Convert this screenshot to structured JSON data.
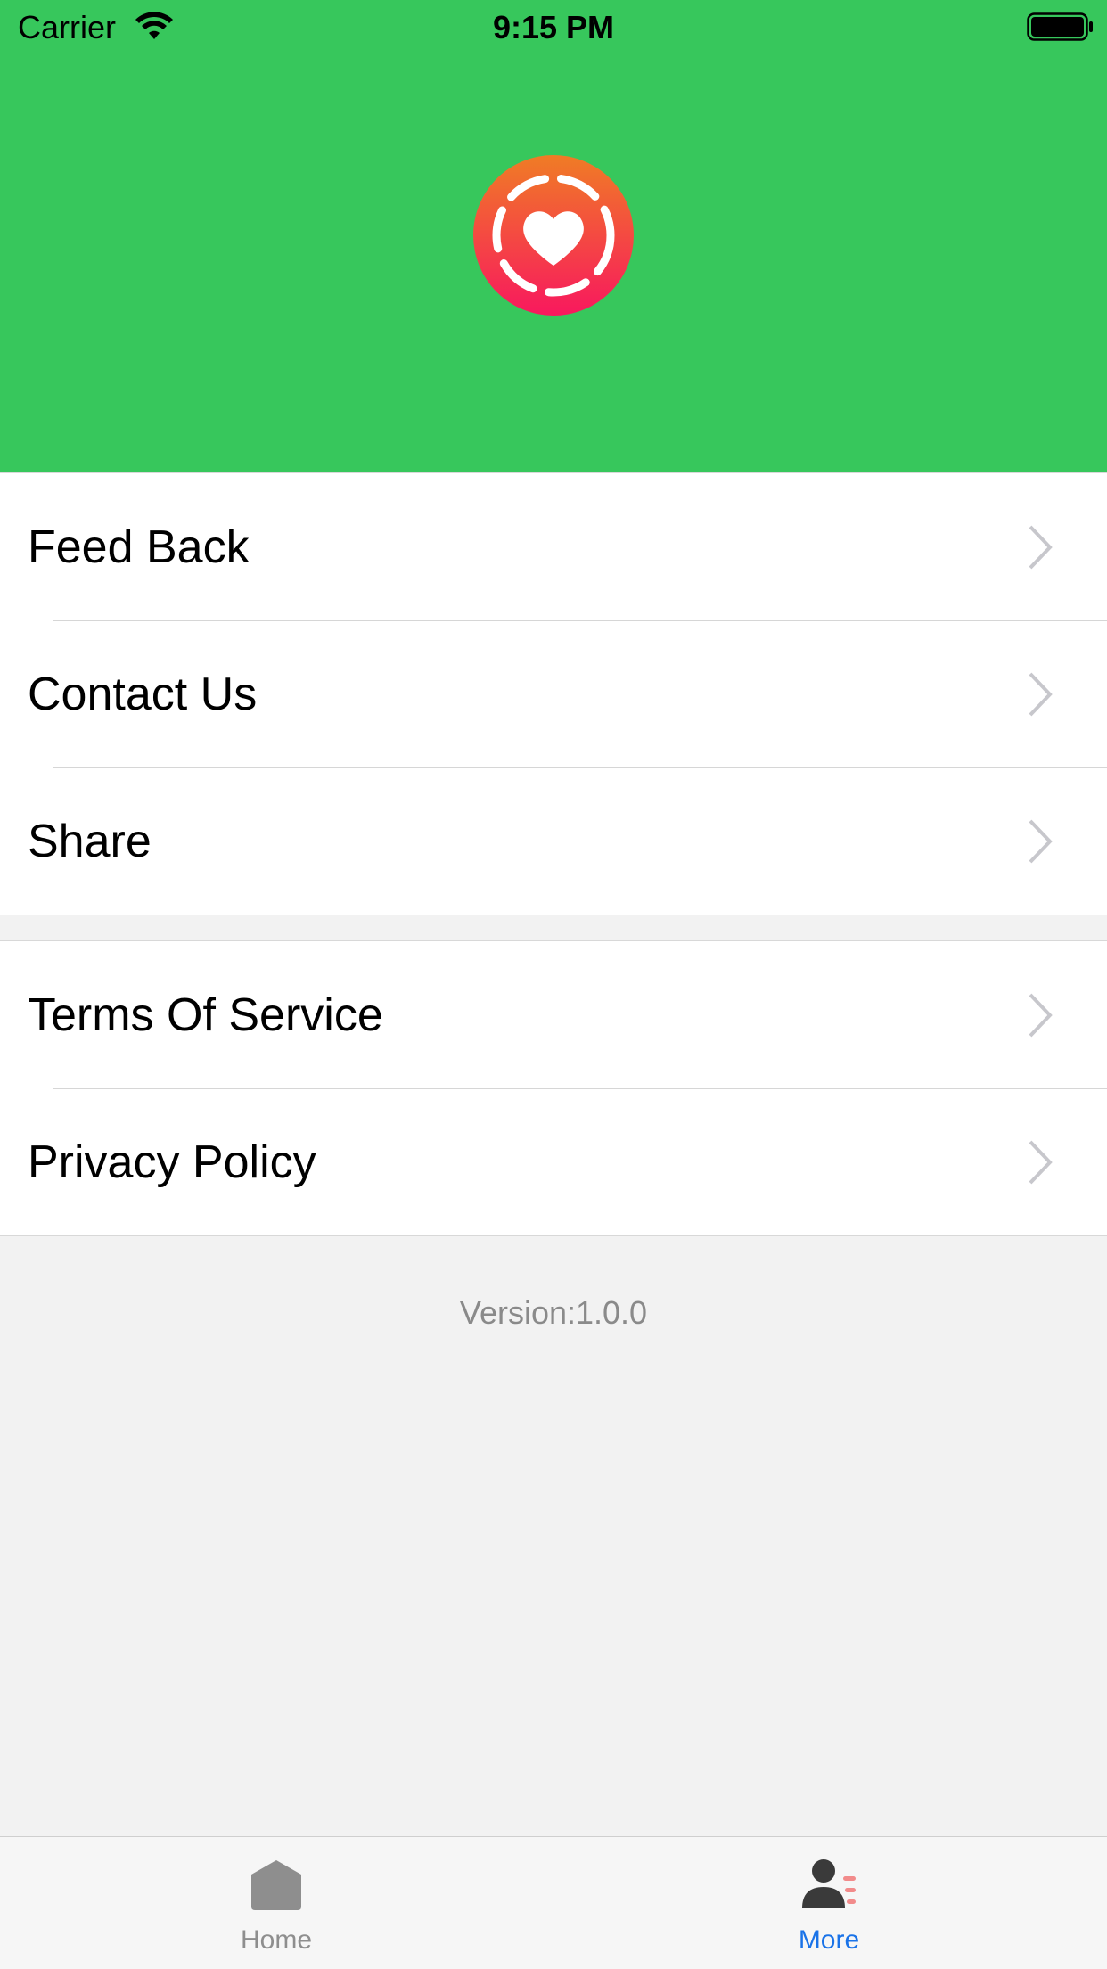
{
  "status_bar": {
    "carrier": "Carrier",
    "time": "9:15 PM",
    "icons": [
      "wifi-icon",
      "battery-icon"
    ]
  },
  "header": {
    "background_color": "#37c75c",
    "logo_icon": "heart-ring-logo"
  },
  "menu": {
    "group1": [
      {
        "label": "Feed Back"
      },
      {
        "label": "Contact Us"
      },
      {
        "label": "Share"
      }
    ],
    "group2": [
      {
        "label": "Terms Of Service"
      },
      {
        "label": "Privacy Policy"
      }
    ]
  },
  "footer": {
    "version": "Version:1.0.0"
  },
  "tab_bar": {
    "tabs": [
      {
        "label": "Home",
        "icon": "home-icon",
        "selected": false
      },
      {
        "label": "More",
        "icon": "person-list-icon",
        "selected": true
      }
    ],
    "active_color": "#1a73e8",
    "inactive_color": "#8e8e8e"
  }
}
